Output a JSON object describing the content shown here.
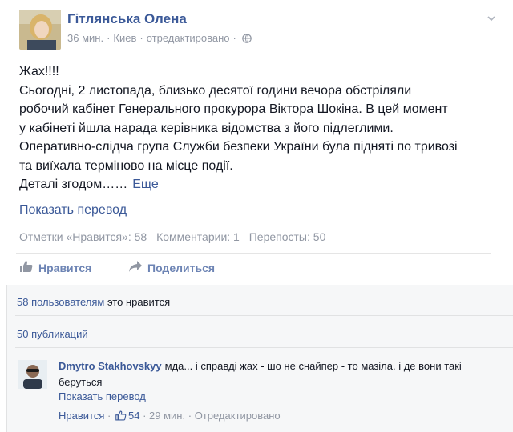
{
  "post": {
    "author": "Гітлянська Олена",
    "time": "36 мин.",
    "location": "Киев",
    "edited": "отредактировано",
    "dot": "·",
    "body_lines": [
      "Жах!!!!",
      "Сьогодні, 2 листопада, близько десятої години вечора обстріляли",
      "робочий кабінет Генерального прокурора Віктора Шокіна. В цей момент",
      "у кабінеті йшла нарада керівника відомства з його підлеглими.",
      "Оперативно-слідча група Служби безпеки України була підняті по тривозі",
      "та виїхала терміново на місце події."
    ],
    "last_line": "Деталі згодом……",
    "more_label": "Еще",
    "translate_label": "Показать перевод",
    "stats": {
      "likes": "Отметки «Нравится»: 58",
      "comments": "Комментарии: 1",
      "shares": "Перепосты: 50"
    },
    "actions": {
      "like": "Нравится",
      "share": "Поделиться"
    }
  },
  "ufi": {
    "likes_count": "58 пользователям",
    "likes_suffix": " это нравится",
    "shares_label": "50 публикаций"
  },
  "comment": {
    "author": "Dmytro Stakhovskyy",
    "text": "мда... і справді жах - шо не снайпер - то мазіла. і де вони такі беруться",
    "translate_label": "Показать перевод",
    "like_label": "Нравится",
    "like_count": "54",
    "time": "29 мин.",
    "edited": "Отредактировано",
    "dot": "·"
  },
  "colors": {
    "link": "#3b5998",
    "muted": "#9197a3",
    "action": "#6d84b4",
    "ufi_bg": "#f6f7f8"
  },
  "icons": [
    "globe-icon",
    "chevron-down-icon",
    "thumbs-up-icon",
    "share-arrow-icon"
  ]
}
